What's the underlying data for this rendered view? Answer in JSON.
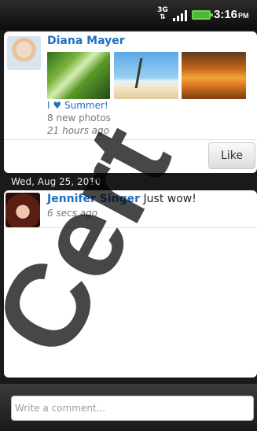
{
  "status_bar": {
    "network": "3G",
    "time": "3:16",
    "ampm": "PM"
  },
  "post": {
    "author": "Diana Mayer",
    "album_title_prefix": "I",
    "album_title_heart": "♥",
    "album_title_suffix": "Summer!",
    "photo_count": "8 new photos",
    "time": "21 hours ago",
    "like_label": "Like"
  },
  "date_header": "Wed, Aug 25, 2010",
  "comment": {
    "author": "Jennifer Singer",
    "text": "Just wow!",
    "time": "6 secs ago"
  },
  "composer": {
    "placeholder": "Write a comment..."
  },
  "watermark": {
    "text": "Cert"
  }
}
